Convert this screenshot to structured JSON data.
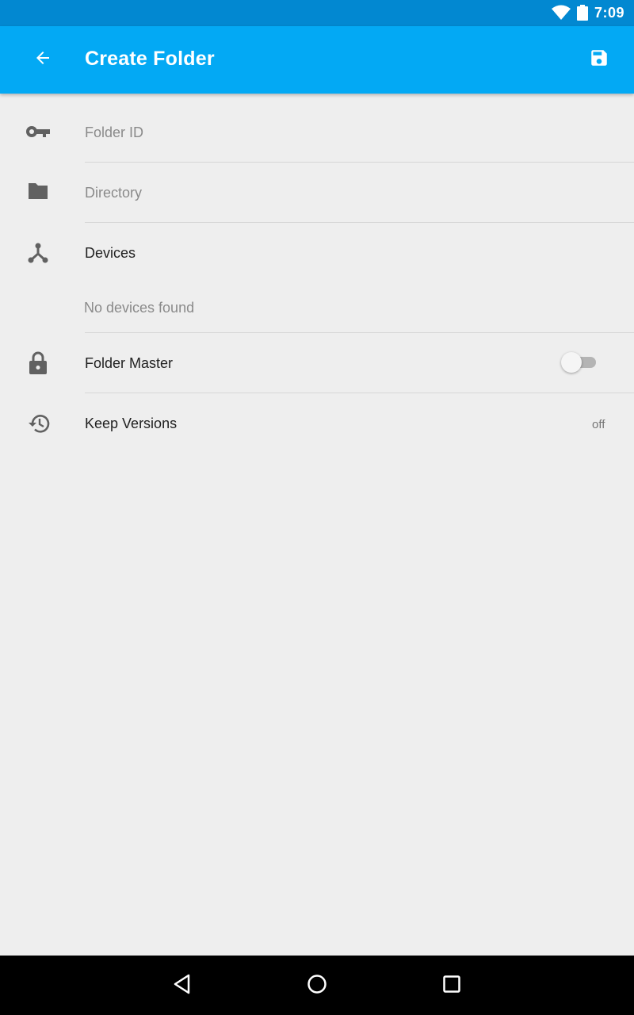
{
  "status_bar": {
    "time": "7:09",
    "battery_level": "87",
    "icons": [
      "wifi-icon",
      "battery-icon"
    ]
  },
  "app_bar": {
    "title": "Create Folder",
    "back_icon": "arrow-back-icon",
    "save_icon": "save-icon",
    "background_color": "#03a9f4",
    "status_color": "#0288d1"
  },
  "form": {
    "folder_id": {
      "placeholder": "Folder ID",
      "icon": "key-icon"
    },
    "directory": {
      "placeholder": "Directory",
      "icon": "folder-icon"
    },
    "devices": {
      "label": "Devices",
      "icon": "devices-icon",
      "empty_text": "No devices found"
    },
    "folder_master": {
      "label": "Folder Master",
      "icon": "lock-icon",
      "enabled": false
    },
    "keep_versions": {
      "label": "Keep Versions",
      "icon": "history-icon",
      "value": "off"
    }
  },
  "nav_bar": {
    "buttons": [
      "back-triangle-icon",
      "home-circle-icon",
      "recents-square-icon"
    ]
  }
}
